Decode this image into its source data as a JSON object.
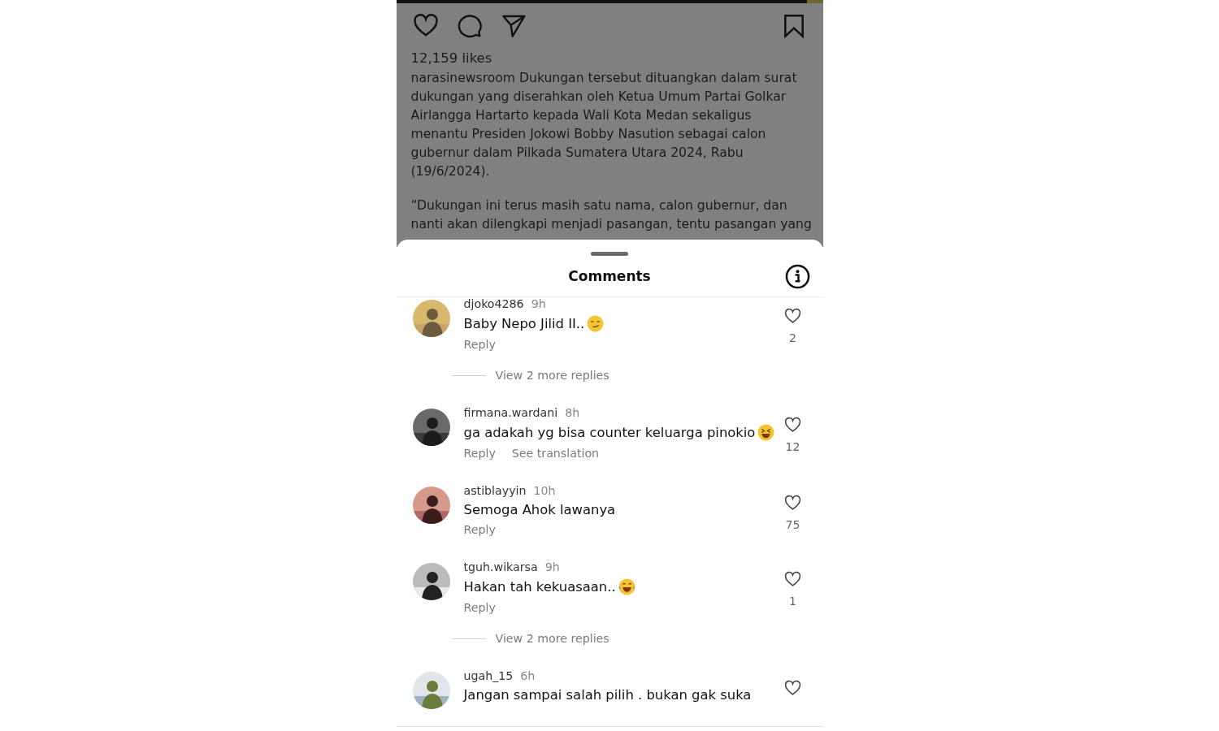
{
  "post": {
    "likes": "12,159 likes",
    "caption": [
      "narasinewsroom Dukungan tersebut dituangkan dalam surat dukungan yang diserahkan oleh Ketua Umum Partai Golkar Airlangga Hartarto kepada Wali Kota Medan sekaligus menantu Presiden Jokowi Bobby Nasution sebagai calon gubernur dalam Pilkada Sumatera Utara 2024, Rabu (19/6/2024).",
      "“Dukungan ini terus masih satu nama, calon gubernur, dan",
      "nanti akan dilengkapi menjadi pasangan, tentu pasangan yang"
    ]
  },
  "sheet": {
    "title": "Comments"
  },
  "comments": [
    {
      "avatar": {
        "kind": "picture"
      },
      "user": "djoko4286",
      "time": "9h",
      "text": "Baby Nepo Jilid II..",
      "emoji": {
        "kind": "smirk"
      },
      "actions": [
        "Reply"
      ],
      "likes": "2",
      "more_replies": "View 2 more replies"
    },
    {
      "avatar": {
        "kind": "picture"
      },
      "user": "firmana.wardani",
      "time": "8h",
      "text": "ga adakah yg bisa counter keluarga pinokio",
      "emoji": {
        "kind": "grin"
      },
      "actions": [
        "Reply",
        "See translation"
      ],
      "likes": "12"
    },
    {
      "avatar": {
        "kind": "picture"
      },
      "user": "astiblayyin",
      "time": "10h",
      "text": "Semoga Ahok lawanya",
      "actions": [
        "Reply"
      ],
      "likes": "75"
    },
    {
      "avatar": {
        "kind": "picture"
      },
      "user": "tguh.wikarsa",
      "time": "9h",
      "text": "Hakan tah kekuasaan..",
      "emoji": {
        "kind": "tears"
      },
      "actions": [
        "Reply"
      ],
      "likes": "1",
      "more_replies": "View 2 more replies"
    },
    {
      "avatar": {
        "kind": "picture"
      },
      "user": "ugah_15",
      "time": "6h",
      "text": "Jangan sampai salah pilih . bukan gak suka"
    }
  ]
}
